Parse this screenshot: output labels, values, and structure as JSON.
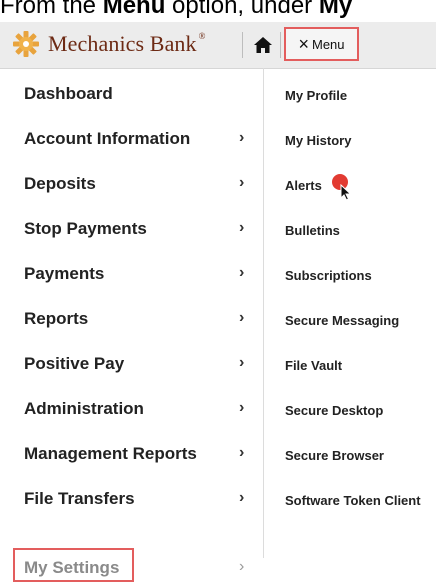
{
  "caption": {
    "prefix": "From the ",
    "menu_word": "Menu",
    "middle": " option, under ",
    "tail": "My"
  },
  "topbar": {
    "logo_text": "Mechanics Bank",
    "logo_tm": "®",
    "menu_label": "Menu",
    "close_glyph": "×"
  },
  "nav": {
    "chevron": "›",
    "items": [
      {
        "label": "Dashboard",
        "chevron": false
      },
      {
        "label": "Account Information",
        "chevron": true
      },
      {
        "label": "Deposits",
        "chevron": true
      },
      {
        "label": "Stop Payments",
        "chevron": true
      },
      {
        "label": "Payments",
        "chevron": true
      },
      {
        "label": "Reports",
        "chevron": true
      },
      {
        "label": "Positive Pay",
        "chevron": true
      },
      {
        "label": "Administration",
        "chevron": true
      },
      {
        "label": "Management Reports",
        "chevron": true
      },
      {
        "label": "File Transfers",
        "chevron": true
      },
      {
        "label": "My Settings",
        "chevron": true
      }
    ]
  },
  "submenu": {
    "items": [
      "My Profile",
      "My History",
      "Alerts",
      "Bulletins",
      "Subscriptions",
      "Secure Messaging",
      "File Vault",
      "Secure Desktop",
      "Secure Browser",
      "Software Token Client"
    ]
  },
  "colors": {
    "highlight": "#e35d5d",
    "brand": "#6d2a14",
    "logo_gold": "#e8a33d",
    "cursor_dot": "#e23b32"
  },
  "icons": {
    "logo": "gear-sunburst-logo-icon",
    "home": "home-icon",
    "close": "close-icon",
    "pointer": "mouse-pointer-icon"
  }
}
